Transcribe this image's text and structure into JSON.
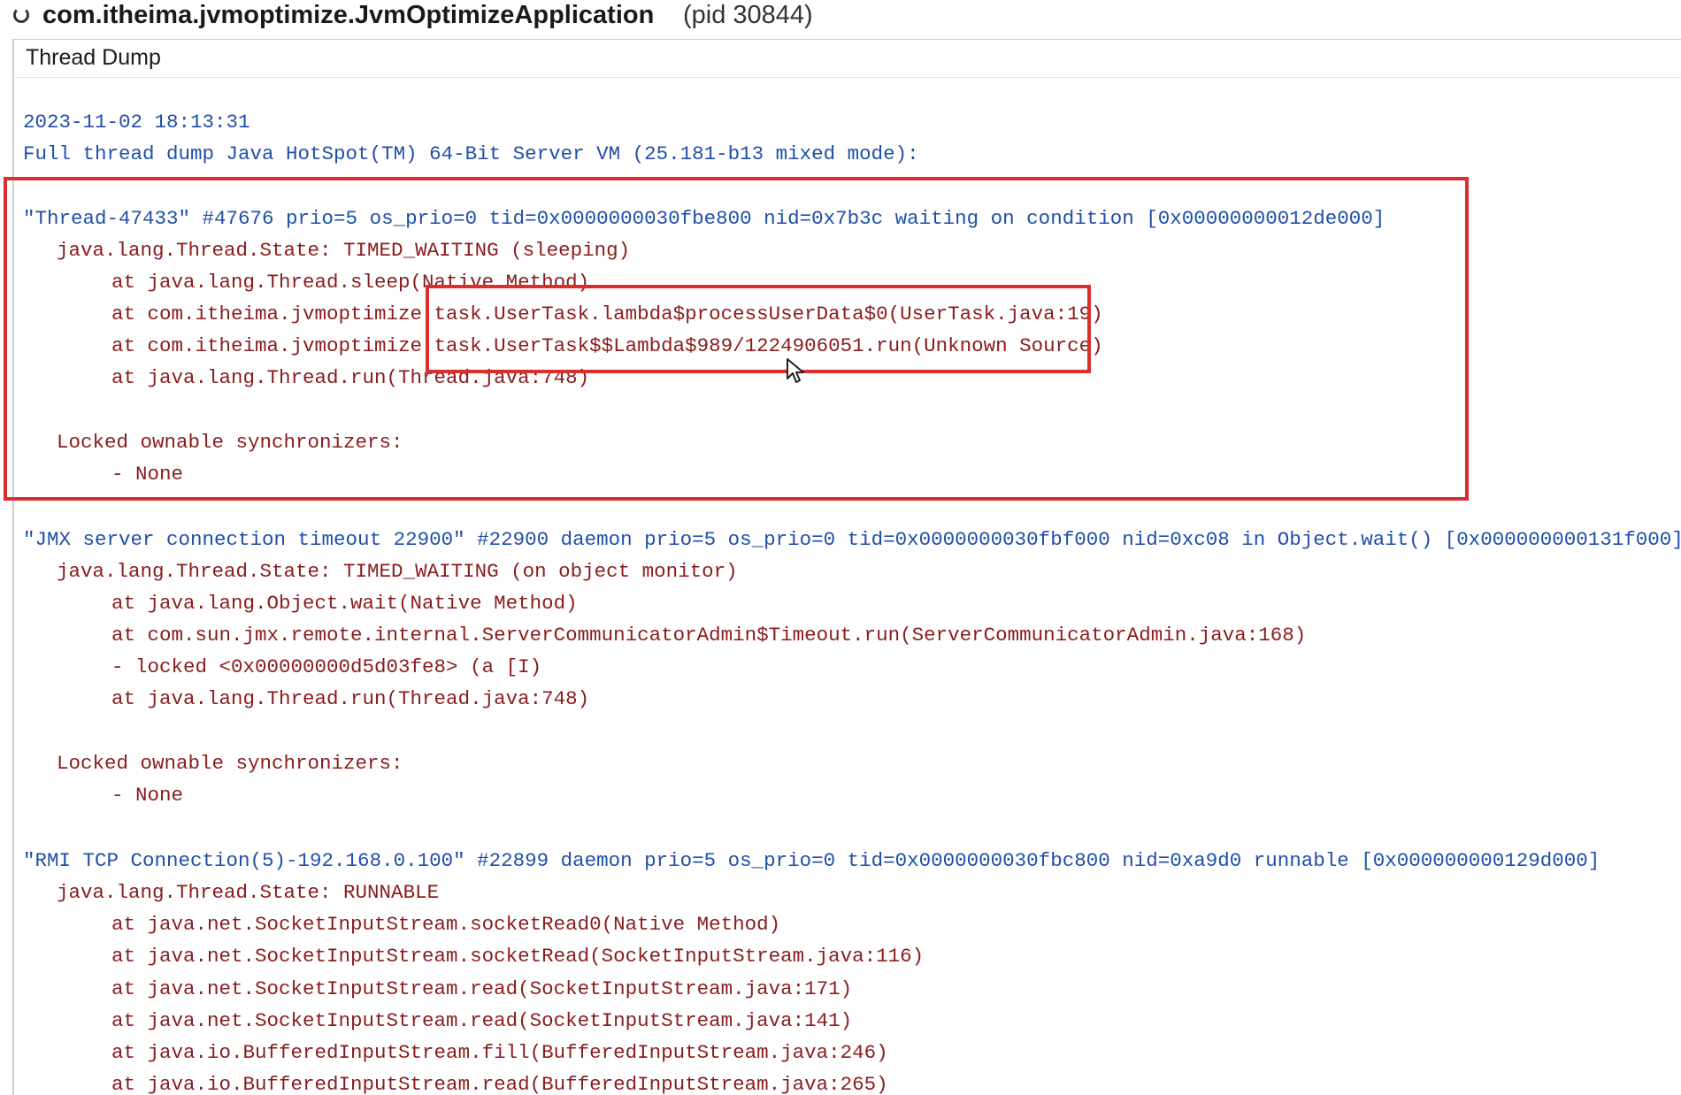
{
  "window": {
    "title": "com.itheima.jvmoptimize.JvmOptimizeApplication",
    "pid": "(pid 30844)",
    "icon": "spinner-icon"
  },
  "panel": {
    "tab_label": "Thread Dump"
  },
  "colors": {
    "header_text": "#1f4fa8",
    "stack_text": "#8a1c1c",
    "highlight_box": "#d9302f"
  },
  "dump": {
    "timestamp": "2023-11-02 18:13:31",
    "header": "Full thread dump Java HotSpot(TM) 64-Bit Server VM (25.181-b13 mixed mode):",
    "threads": [
      {
        "header": "\"Thread-47433\" #47676 prio=5 os_prio=0 tid=0x0000000030fbe800 nid=0x7b3c waiting on condition [0x00000000012de000]",
        "state": "java.lang.Thread.State: TIMED_WAITING (sleeping)",
        "frames": [
          "at java.lang.Thread.sleep(Native Method)",
          "at com.itheima.jvmoptimize.task.UserTask.lambda$processUserData$0(UserTask.java:19)",
          "at com.itheima.jvmoptimize.task.UserTask$$Lambda$989/1224906051.run(Unknown Source)",
          "at java.lang.Thread.run(Thread.java:748)"
        ],
        "sync_label": "Locked ownable synchronizers:",
        "sync_value": "- None"
      },
      {
        "header": "\"JMX server connection timeout 22900\" #22900 daemon prio=5 os_prio=0 tid=0x0000000030fbf000 nid=0xc08 in Object.wait() [0x000000000131f000]",
        "state": "java.lang.Thread.State: TIMED_WAITING (on object monitor)",
        "frames": [
          "at java.lang.Object.wait(Native Method)",
          "at com.sun.jmx.remote.internal.ServerCommunicatorAdmin$Timeout.run(ServerCommunicatorAdmin.java:168)",
          "- locked <0x00000000d5d03fe8> (a [I)",
          "at java.lang.Thread.run(Thread.java:748)"
        ],
        "sync_label": "Locked ownable synchronizers:",
        "sync_value": "- None"
      },
      {
        "header": "\"RMI TCP Connection(5)-192.168.0.100\" #22899 daemon prio=5 os_prio=0 tid=0x0000000030fbc800 nid=0xa9d0 runnable [0x000000000129d000]",
        "state": "java.lang.Thread.State: RUNNABLE",
        "frames": [
          "at java.net.SocketInputStream.socketRead0(Native Method)",
          "at java.net.SocketInputStream.socketRead(SocketInputStream.java:116)",
          "at java.net.SocketInputStream.read(SocketInputStream.java:171)",
          "at java.net.SocketInputStream.read(SocketInputStream.java:141)",
          "at java.io.BufferedInputStream.fill(BufferedInputStream.java:246)",
          "at java.io.BufferedInputStream.read(BufferedInputStream.java:265)"
        ]
      }
    ]
  }
}
